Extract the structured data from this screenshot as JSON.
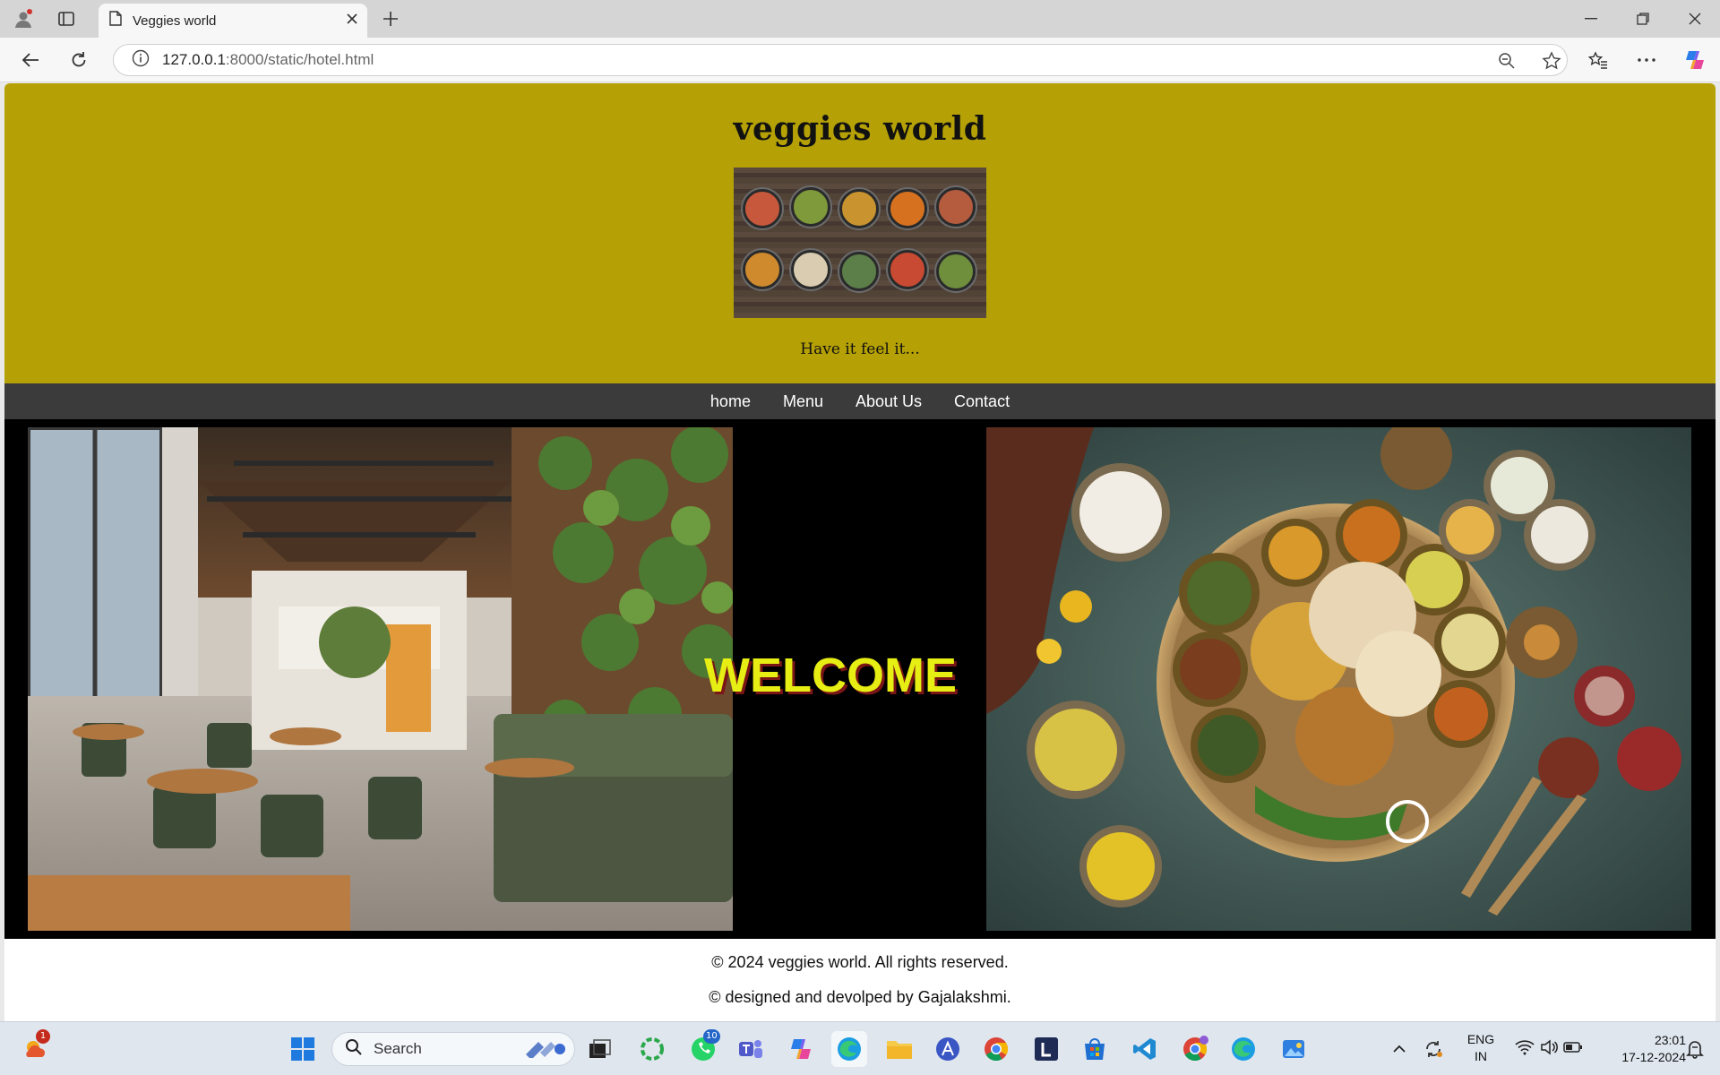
{
  "browser": {
    "tab_title": "Veggies world",
    "url_host": "127.0.0.1",
    "url_rest": ":8000/static/hotel.html"
  },
  "site": {
    "title": "veggies world",
    "tagline": "Have it feel it...",
    "nav": [
      "home",
      "Menu",
      "About Us",
      "Contact"
    ],
    "welcome": "WELCOME",
    "footer": {
      "copyright": "© 2024 veggies world. All rights reserved.",
      "credit": "© designed and devolped by Gajalakshmi."
    }
  },
  "taskbar": {
    "search_placeholder": "Search",
    "weather_badge": "1",
    "whatsapp_badge": "10",
    "lang_top": "ENG",
    "lang_bottom": "IN",
    "time": "23:01",
    "date": "17-12-2024"
  },
  "colors": {
    "header_bg": "#b5a105",
    "nav_bg": "#3b3b3b",
    "welcome_text": "#e6ee13",
    "banner_bg": "#000000"
  }
}
